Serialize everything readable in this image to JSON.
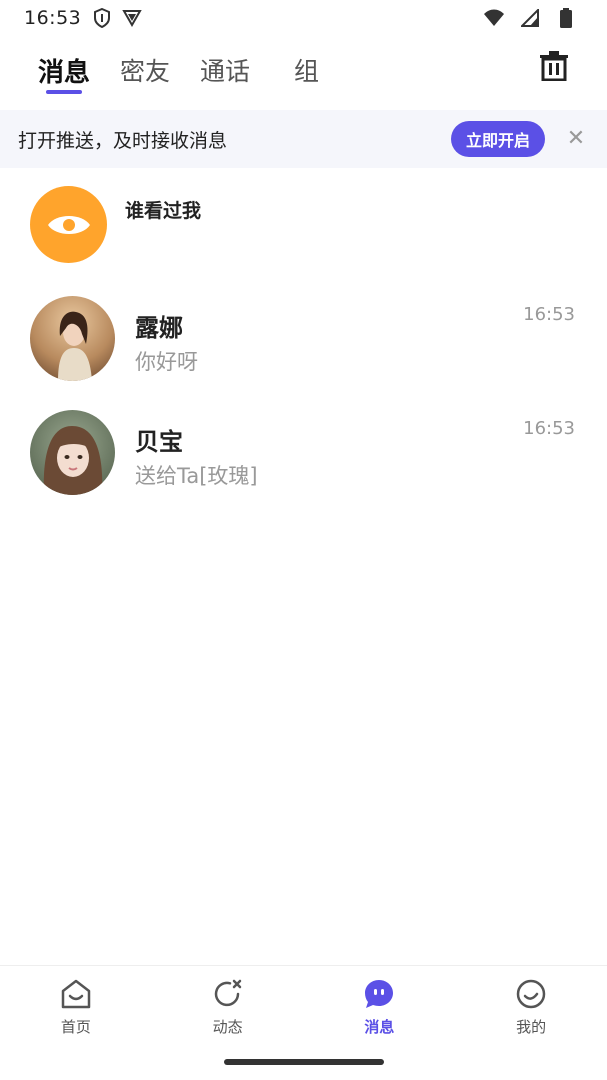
{
  "status_bar": {
    "time": "16:53"
  },
  "tabs": [
    {
      "label": "消息",
      "active": true
    },
    {
      "label": "密友",
      "active": false
    },
    {
      "label": "通话",
      "active": false
    },
    {
      "label": "组",
      "active": false
    }
  ],
  "icons": {
    "trash": "trash-icon",
    "close": "close-icon",
    "eye": "eye-icon"
  },
  "push_banner": {
    "text": "打开推送，及时接收消息",
    "button_label": "立即开启",
    "close_glyph": "✕"
  },
  "viewer": {
    "title": "谁看过我"
  },
  "chats": [
    {
      "name": "露娜",
      "message": "你好呀",
      "time": "16:53"
    },
    {
      "name": "贝宝",
      "message": "送给Ta[玫瑰]",
      "time": "16:53"
    }
  ],
  "bottom_nav": [
    {
      "label": "首页",
      "icon": "home-icon",
      "active": false
    },
    {
      "label": "动态",
      "icon": "refresh-icon",
      "active": false
    },
    {
      "label": "消息",
      "icon": "chat-icon",
      "active": true
    },
    {
      "label": "我的",
      "icon": "profile-icon",
      "active": false
    }
  ],
  "colors": {
    "accent": "#5b50e6",
    "viewer_orange": "#ffa42c",
    "banner_bg": "#f5f6fb"
  }
}
